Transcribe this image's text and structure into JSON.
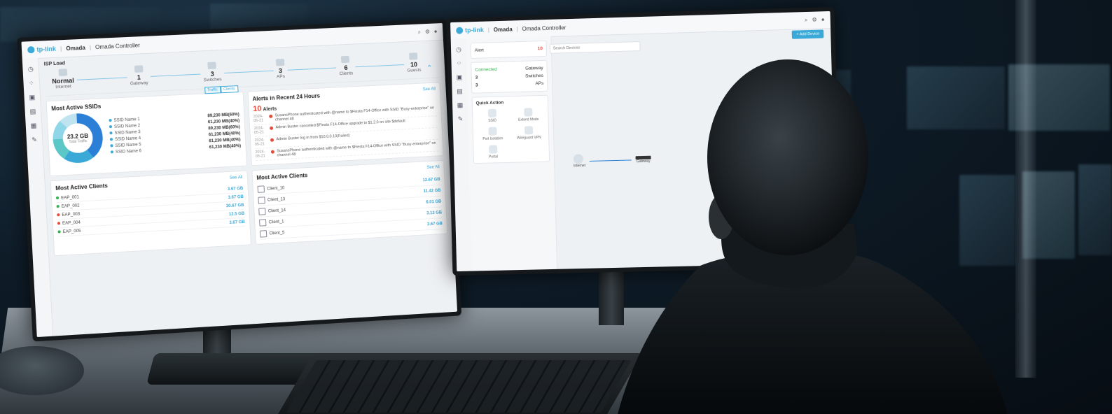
{
  "monitor_left": {
    "brand": "tp-link",
    "product": "Omada",
    "app_title": "Omada Controller",
    "isp_label": "ISP Load",
    "topology": [
      {
        "num": "Normal",
        "label": "Internet"
      },
      {
        "num": "1",
        "label": "Gateway"
      },
      {
        "num": "3",
        "label": "Switches"
      },
      {
        "num": "3",
        "label": "APs"
      },
      {
        "num": "6",
        "label": "Clients"
      },
      {
        "num": "10",
        "label": "Guests"
      }
    ],
    "ssids": {
      "title": "Most Active SSIDs",
      "toggle": [
        "Traffic",
        "Clients"
      ],
      "total": "23.2 GB",
      "total_label": "Total Traffic",
      "items": [
        {
          "name": "SSID Name 1",
          "value": "89,230 MB(60%)"
        },
        {
          "name": "SSID Name 2",
          "value": "61,230 MB(40%)"
        },
        {
          "name": "SSID Name 3",
          "value": "89,230 MB(60%)"
        },
        {
          "name": "SSID Name 4",
          "value": "61,230 MB(40%)"
        },
        {
          "name": "SSID Name 5",
          "value": "61,230 MB(40%)"
        },
        {
          "name": "SSID Name 6",
          "value": "61,230 MB(40%)"
        }
      ]
    },
    "alerts": {
      "title": "Alerts in Recent 24 Hours",
      "count": "10",
      "count_label": "Alerts",
      "see_all": "See All",
      "items": [
        {
          "date": "2024-05-21",
          "text": "SusansPhone authenticated with @name to $Fiesta F14-Office with SSID \"Busy-enterprise\" on channel 48"
        },
        {
          "date": "2024-05-21",
          "text": "Admin Buster cancelled $Fiesta F14-Office upgrade to $1.2.0 on site $default"
        },
        {
          "date": "2024-05-21",
          "text": "Admin Buster log in from $10.0.0.10(Failed)"
        },
        {
          "date": "2024-05-21",
          "text": "SusansPhone authenticated with @name to $Fiesta F14-Office with SSID \"Busy-enterprise\" on channel 48"
        }
      ]
    },
    "clients_left": {
      "title": "Most Active Clients",
      "see_all": "See All",
      "items": [
        {
          "name": "EAP_001",
          "value": "3.67 GB",
          "status": "#2fb34a"
        },
        {
          "name": "EAP_002",
          "value": "3.67 GB",
          "status": "#2fb34a"
        },
        {
          "name": "EAP_003",
          "value": "30.67 GB",
          "status": "#e04b3b"
        },
        {
          "name": "EAP_004",
          "value": "12.5 GB",
          "status": "#e04b3b"
        },
        {
          "name": "EAP_005",
          "value": "3.67 GB",
          "status": "#2fb34a"
        }
      ]
    },
    "clients_right": {
      "title": "Most Active Clients",
      "see_all": "See All",
      "items": [
        {
          "name": "Client_10",
          "value": "12.67 GB"
        },
        {
          "name": "Client_13",
          "value": "11.42 GB"
        },
        {
          "name": "Client_14",
          "value": "6.01 GB"
        },
        {
          "name": "Client_1",
          "value": "3.13 GB"
        },
        {
          "name": "Client_5",
          "value": "3.67 GB"
        }
      ]
    }
  },
  "monitor_right": {
    "brand": "tp-link",
    "product": "Omada",
    "app_title": "Omada Controller",
    "search_placeholder": "Search Devices",
    "button": "+ Add Device",
    "alert_label": "Alert",
    "alert_count": "10",
    "status": [
      {
        "num": "",
        "label": "Connected",
        "sub": "Gateway"
      },
      {
        "num": "3",
        "label": "Switches"
      },
      {
        "num": "3",
        "label": "APs"
      }
    ],
    "quick_action": {
      "title": "Quick Action",
      "items": [
        "SSID",
        "Extend Mode",
        "Port Isolation",
        "Wireguard VPN",
        "Portal"
      ]
    },
    "topo": {
      "left": "Internet",
      "right": "Gateway"
    }
  },
  "colors": {
    "accent": "#3aa9d8",
    "alert": "#e04b3b",
    "ok": "#2fb34a"
  }
}
